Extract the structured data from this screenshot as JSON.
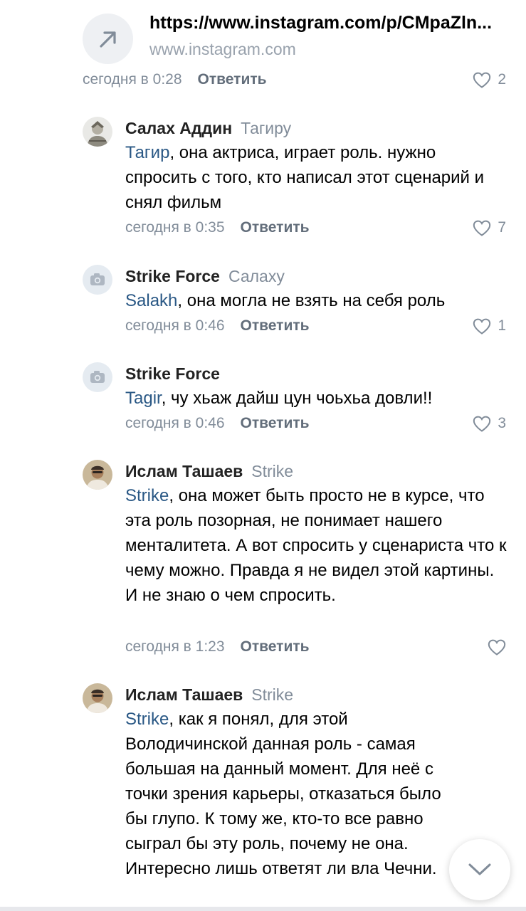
{
  "link_preview": {
    "title": "https://www.instagram.com/p/CMpaZln...",
    "domain": "www.instagram.com",
    "icon": "arrow-up-right-icon"
  },
  "post_meta": {
    "time": "сегодня в 0:28",
    "reply_label": "Ответить",
    "likes": "2"
  },
  "comments": [
    {
      "author": "Салах Аддин",
      "reply_to": "Тагиру",
      "mention": "Тагир",
      "text": ", она актриса, играет роль. нужно спросить с того, кто написал этот сценарий и снял фильм",
      "time": "сегодня в 0:35",
      "reply_label": "Ответить",
      "likes": "7",
      "avatar": "photo"
    },
    {
      "author": "Strike Force",
      "reply_to": "Салаху",
      "mention": "Salakh",
      "text": ", она могла не взять на себя роль",
      "time": "сегодня в 0:46",
      "reply_label": "Ответить",
      "likes": "1",
      "avatar": "camera-placeholder"
    },
    {
      "author": "Strike Force",
      "reply_to": "",
      "mention": "Tagir",
      "text": ", чу хьаж дайш цун чоьхьа довли!!",
      "time": "сегодня в 0:46",
      "reply_label": "Ответить",
      "likes": "3",
      "avatar": "camera-placeholder"
    },
    {
      "author": "Ислам Ташаев",
      "reply_to": "Strike",
      "mention": "Strike",
      "text": ", она может быть просто не в курсе, что эта роль позорная, не понимает нашего менталитета. А вот спросить у сценариста что к чему можно. Правда я не видел этой картины. И не знаю о чем спросить.",
      "time": "сегодня в 1:23",
      "reply_label": "Ответить",
      "likes": "",
      "avatar": "photo"
    },
    {
      "author": "Ислам Ташаев",
      "reply_to": "Strike",
      "mention": "Strike",
      "text": ", как я понял, для этой Володичинской данная роль - самая большая на данный момент. Для неё с точки зрения карьеры, отказаться было бы глупо. К тому же, кто-то все равно сыграл бы эту роль, почему не она. Интересно лишь ответят ли вла Чечни.",
      "time": "",
      "reply_label": "",
      "likes": "",
      "avatar": "photo"
    }
  ],
  "scroll_down": {
    "icon": "chevron-down-icon"
  },
  "colors": {
    "link": "#2a5885",
    "secondary": "#818c99",
    "reply": "#626d7a",
    "placeholder": "#e5ebf1"
  }
}
